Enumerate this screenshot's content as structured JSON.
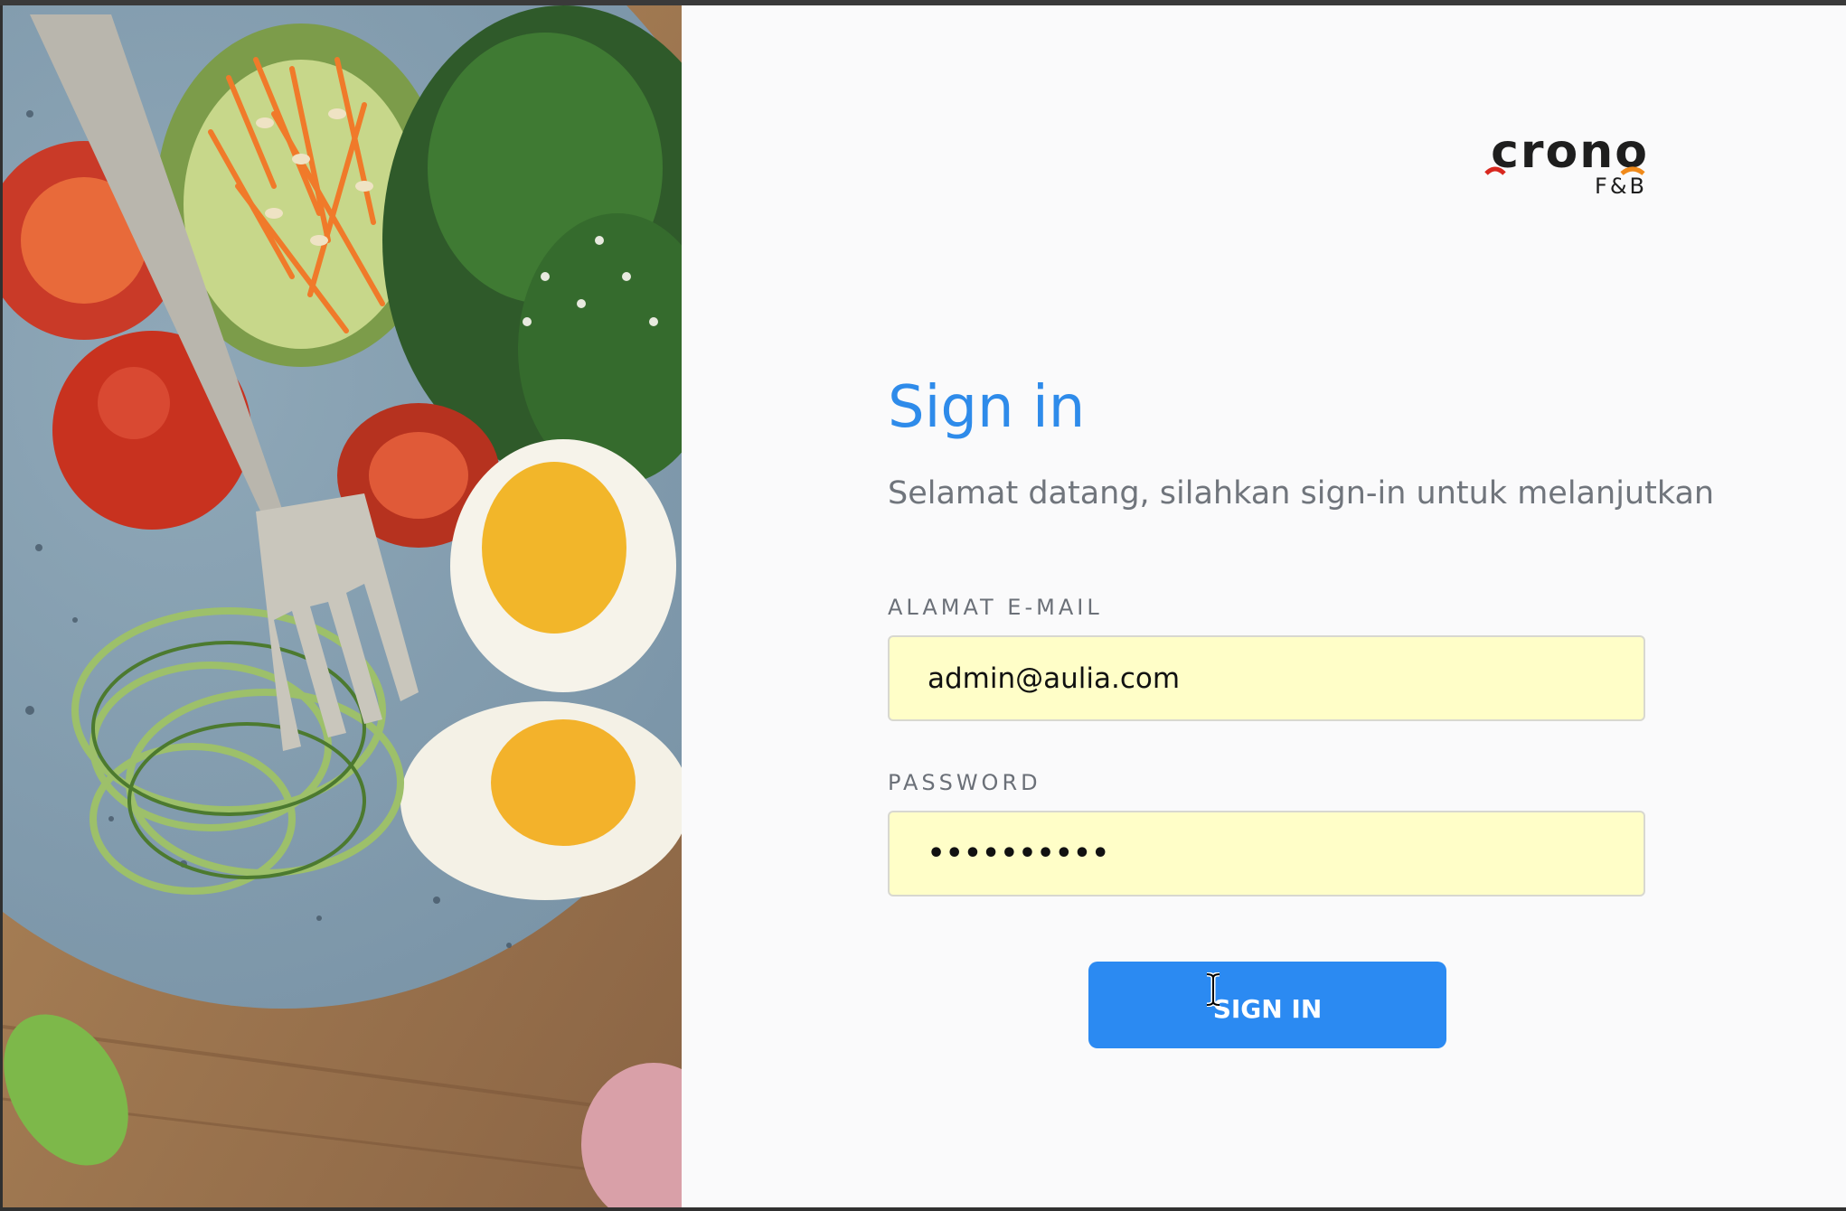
{
  "photo": {
    "description_icon": "salad-bowl-photo"
  },
  "logo": {
    "word": "crono",
    "sub": "F&B"
  },
  "form": {
    "title": "Sign in",
    "subtitle": "Selamat datang, silahkan sign-in untuk melanjutkan",
    "email_label": "ALAMAT E-MAIL",
    "email_value": "admin@aulia.com",
    "password_label": "PASSWORD",
    "password_value": "••••••••••",
    "submit_label": "SIGN IN"
  },
  "colors": {
    "accent": "#2b8af2",
    "title": "#2e8bea",
    "field_bg": "#fffec8",
    "panel_bg": "#fafafb"
  }
}
